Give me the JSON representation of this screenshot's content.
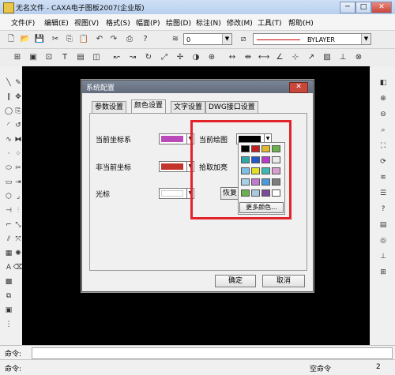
{
  "window": {
    "title": "无名文件 - CAXA电子图板2007(企业版)",
    "buttons": {
      "minimize": "─",
      "maximize": "□",
      "close": "✕"
    }
  },
  "menubar": {
    "items": [
      "文件(F)",
      "编辑(E)",
      "视图(V)",
      "格式(S)",
      "幅面(P)",
      "绘图(D)",
      "标注(N)",
      "修改(M)",
      "工具(T)",
      "帮助(H)"
    ]
  },
  "toolbar": {
    "layer_value": "0",
    "linetype_value": "BYLAYER"
  },
  "dialog": {
    "title": "系统配置",
    "close": "✕",
    "tabs": [
      "参数设置",
      "颜色设置",
      "文字设置",
      "DWG接口设置"
    ],
    "active_tab": 1,
    "rows": [
      {
        "label": "当前坐标系",
        "color": "#b94ab8"
      },
      {
        "label": "非当前坐标",
        "color": "#c3352c"
      },
      {
        "label": "光标",
        "color": "#ffffff"
      }
    ],
    "current_draw_label": "当前绘图",
    "current_draw_color": "#000000",
    "pick_highlight_label": "拾取加亮",
    "restore_label": "恢复",
    "ok_label": "确定",
    "cancel_label": "取消"
  },
  "palette": {
    "colors": [
      "#000000",
      "#c41f1f",
      "#e0b830",
      "#6ab04c",
      "#2fa8a8",
      "#2356c6",
      "#b43cc7",
      "#e9e9e9",
      "#7dc0e6",
      "#e0e026",
      "#3fb8b0",
      "#d8a0d0",
      "#a8d0e8",
      "#c07ad0",
      "#4d9ad8",
      "#7d7d7d",
      "#6ab04c",
      "#aac8e0",
      "#7c4a98",
      "#ffffff"
    ],
    "more_label": "更多颜色..."
  },
  "colors": {
    "highlight": "#e2242a",
    "arrow": "#e2242a"
  },
  "cmd": {
    "label": "命令:"
  },
  "status": {
    "left": "命令:",
    "mode": "空命令",
    "value": "2"
  }
}
